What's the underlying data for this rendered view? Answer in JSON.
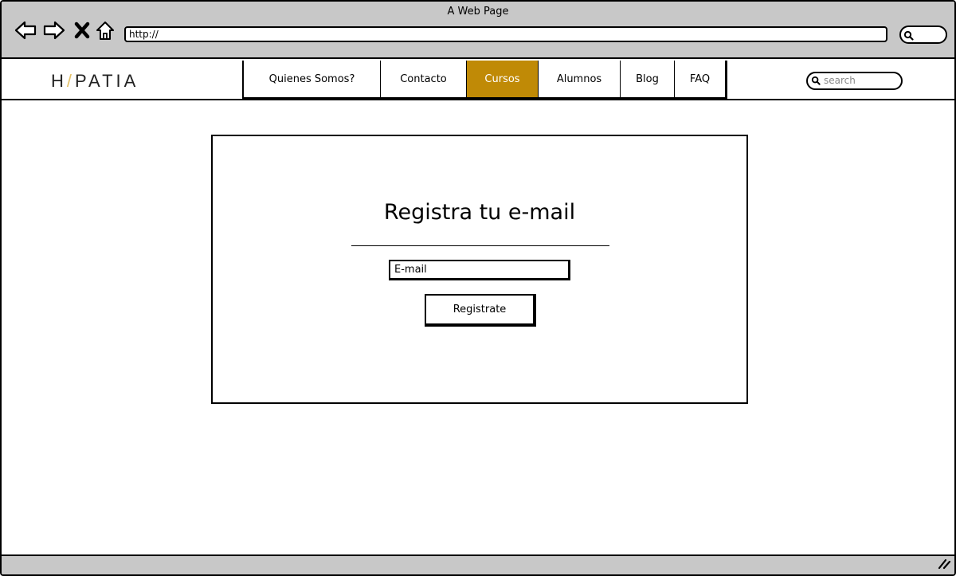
{
  "window": {
    "title": "A Web Page"
  },
  "browser": {
    "back_icon": "back-arrow-icon",
    "forward_icon": "forward-arrow-icon",
    "stop_icon": "close-x-icon",
    "home_icon": "home-icon",
    "url": "http://",
    "search_icon": "magnifier-icon"
  },
  "header": {
    "logo_left": "H",
    "logo_slash": "/",
    "logo_right": "PATIA",
    "menu": [
      {
        "label": "Quienes Somos?",
        "active": false
      },
      {
        "label": "Contacto",
        "active": false
      },
      {
        "label": "Cursos",
        "active": true
      },
      {
        "label": "Alumnos",
        "active": false
      },
      {
        "label": "Blog",
        "active": false
      },
      {
        "label": "FAQ",
        "active": false
      }
    ],
    "search_placeholder": "search"
  },
  "form": {
    "title": "Registra tu e-mail",
    "email_value": "E-mail",
    "submit_label": "Registrate"
  },
  "colors": {
    "chrome": "#c8c8c8",
    "accent": "#c08a06",
    "logo_slash": "#e4c26a"
  }
}
